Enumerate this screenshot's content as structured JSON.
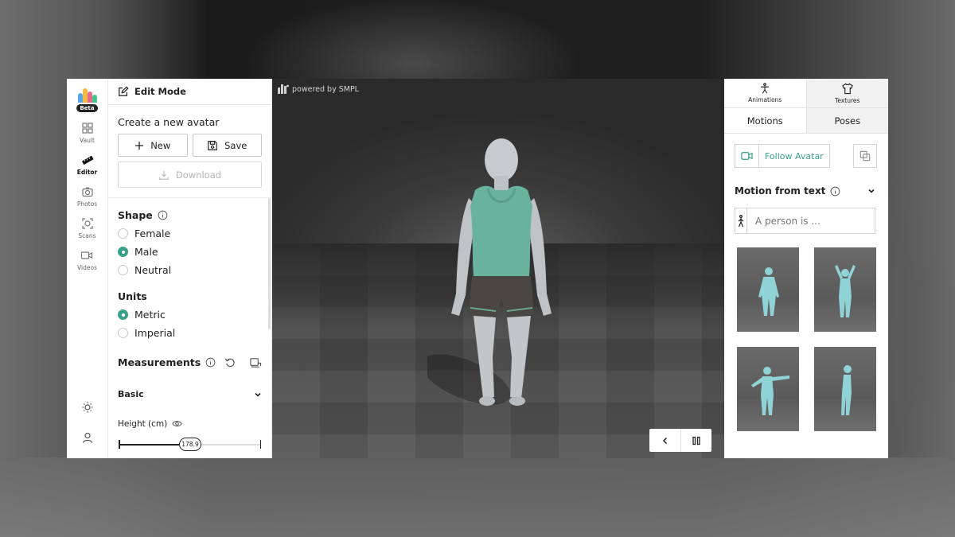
{
  "rail": {
    "beta": "Beta",
    "items": [
      {
        "label": "Vault",
        "icon": "grid-icon"
      },
      {
        "label": "Editor",
        "icon": "ruler-icon"
      },
      {
        "label": "Photos",
        "icon": "camera-icon"
      },
      {
        "label": "Scans",
        "icon": "scan-icon"
      },
      {
        "label": "Videos",
        "icon": "video-icon"
      }
    ],
    "bottom": [
      "sun-icon",
      "user-icon"
    ]
  },
  "editor": {
    "mode_title": "Edit Mode",
    "create_title": "Create a new avatar",
    "new_label": "New",
    "save_label": "Save",
    "download_label": "Download",
    "shape": {
      "title": "Shape",
      "options": [
        "Female",
        "Male",
        "Neutral"
      ],
      "selected": "Male"
    },
    "units": {
      "title": "Units",
      "options": [
        "Metric",
        "Imperial"
      ],
      "selected": "Metric"
    },
    "measurements_title": "Measurements",
    "basic_label": "Basic",
    "height_label": "Height (cm)",
    "height_value": "178.9",
    "height_fraction": 0.5
  },
  "viewport": {
    "powered_by": "powered by SMPL"
  },
  "right": {
    "top_tabs": [
      "Animations",
      "Textures"
    ],
    "active_top_tab": "Animations",
    "sub_tabs": [
      "Motions",
      "Poses"
    ],
    "active_sub_tab": "Motions",
    "follow_label": "Follow Avatar",
    "motion_title": "Motion from text",
    "prompt_placeholder": "A person is ..."
  },
  "colors": {
    "accent": "#3aa18a",
    "figure": "#8fd3d6",
    "logo": [
      "#5aa9e6",
      "#f4b942",
      "#e56b8a",
      "#4cc38a"
    ]
  }
}
